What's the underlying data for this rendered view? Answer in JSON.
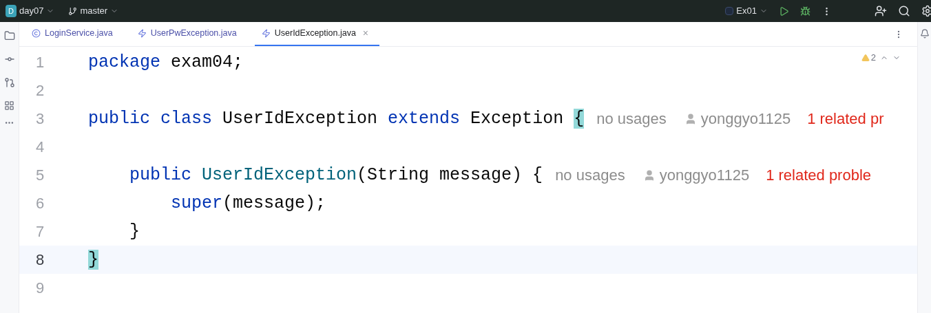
{
  "toolbar": {
    "project_badge": "D",
    "project": "day07",
    "branch": "master",
    "run_config": "Ex01"
  },
  "tabs": [
    {
      "label": "LoginService.java",
      "kind": "class",
      "selected": false
    },
    {
      "label": "UserPwException.java",
      "kind": "exception",
      "selected": false
    },
    {
      "label": "UserIdException.java",
      "kind": "exception",
      "selected": true,
      "close": "×"
    }
  ],
  "inspections": {
    "warnings": "2"
  },
  "lines": [
    {
      "number": "1",
      "current": false,
      "tokens": [
        {
          "kind": "keyword",
          "text": "package"
        },
        {
          "kind": "plain",
          "text": " exam04;"
        }
      ]
    },
    {
      "number": "2",
      "current": false
    },
    {
      "number": "3",
      "current": false,
      "tokens": [
        {
          "kind": "keyword",
          "text": "public class"
        },
        {
          "kind": "plain",
          "text": " UserIdException "
        },
        {
          "kind": "keyword",
          "text": "extends"
        },
        {
          "kind": "plain",
          "text": " Exception "
        },
        {
          "kind": "brace",
          "text": "{"
        }
      ],
      "hints": {
        "usages": "no usages",
        "author": "yonggyo1125",
        "problems": "1 related pr"
      }
    },
    {
      "number": "4",
      "current": false
    },
    {
      "number": "5",
      "current": false,
      "tokens": [
        {
          "kind": "keyword",
          "text": "    public "
        },
        {
          "kind": "function",
          "text": "UserIdException"
        },
        {
          "kind": "plain",
          "text": "(String message) {"
        }
      ],
      "hints": {
        "usages": "no usages",
        "author": "yonggyo1125",
        "problems": "1 related proble"
      }
    },
    {
      "number": "6",
      "current": false,
      "tokens": [
        {
          "kind": "keyword",
          "text": "        super"
        },
        {
          "kind": "plain",
          "text": "(message);"
        }
      ]
    },
    {
      "number": "7",
      "current": false,
      "tokens": [
        {
          "kind": "plain",
          "text": "    }"
        }
      ]
    },
    {
      "number": "8",
      "current": true,
      "tokens": [
        {
          "kind": "brace",
          "text": "}"
        }
      ]
    },
    {
      "number": "9",
      "current": false
    }
  ]
}
